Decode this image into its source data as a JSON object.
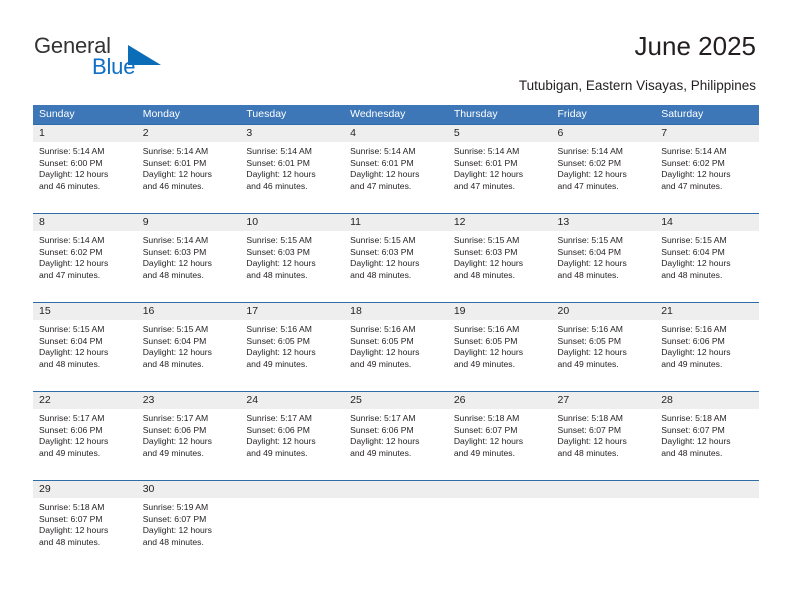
{
  "brand": {
    "name_top": "General",
    "name_bottom": "Blue",
    "triangle_icon": "triangle-icon",
    "color_top": "#333333",
    "color_bottom": "#0f6fc5",
    "color_triangle": "#0b6cb7"
  },
  "header": {
    "title": "June 2025",
    "subtitle": "Tutubigan, Eastern Visayas, Philippines"
  },
  "theme": {
    "header_bg": "#3d77b8",
    "header_text": "#ffffff",
    "daynum_bg": "#eeeeee",
    "week_divider": "#2e6da8",
    "body_text": "#231f20"
  },
  "calendar": {
    "weekday_headers": [
      "Sunday",
      "Monday",
      "Tuesday",
      "Wednesday",
      "Thursday",
      "Friday",
      "Saturday"
    ],
    "weeks": [
      {
        "daynums": [
          "1",
          "2",
          "3",
          "4",
          "5",
          "6",
          "7"
        ],
        "days": [
          {
            "day": "1",
            "sunrise": "Sunrise: 5:14 AM",
            "sunset": "Sunset: 6:00 PM",
            "daylight1": "Daylight: 12 hours",
            "daylight2": "and 46 minutes."
          },
          {
            "day": "2",
            "sunrise": "Sunrise: 5:14 AM",
            "sunset": "Sunset: 6:01 PM",
            "daylight1": "Daylight: 12 hours",
            "daylight2": "and 46 minutes."
          },
          {
            "day": "3",
            "sunrise": "Sunrise: 5:14 AM",
            "sunset": "Sunset: 6:01 PM",
            "daylight1": "Daylight: 12 hours",
            "daylight2": "and 46 minutes."
          },
          {
            "day": "4",
            "sunrise": "Sunrise: 5:14 AM",
            "sunset": "Sunset: 6:01 PM",
            "daylight1": "Daylight: 12 hours",
            "daylight2": "and 47 minutes."
          },
          {
            "day": "5",
            "sunrise": "Sunrise: 5:14 AM",
            "sunset": "Sunset: 6:01 PM",
            "daylight1": "Daylight: 12 hours",
            "daylight2": "and 47 minutes."
          },
          {
            "day": "6",
            "sunrise": "Sunrise: 5:14 AM",
            "sunset": "Sunset: 6:02 PM",
            "daylight1": "Daylight: 12 hours",
            "daylight2": "and 47 minutes."
          },
          {
            "day": "7",
            "sunrise": "Sunrise: 5:14 AM",
            "sunset": "Sunset: 6:02 PM",
            "daylight1": "Daylight: 12 hours",
            "daylight2": "and 47 minutes."
          }
        ]
      },
      {
        "daynums": [
          "8",
          "9",
          "10",
          "11",
          "12",
          "13",
          "14"
        ],
        "days": [
          {
            "day": "8",
            "sunrise": "Sunrise: 5:14 AM",
            "sunset": "Sunset: 6:02 PM",
            "daylight1": "Daylight: 12 hours",
            "daylight2": "and 47 minutes."
          },
          {
            "day": "9",
            "sunrise": "Sunrise: 5:14 AM",
            "sunset": "Sunset: 6:03 PM",
            "daylight1": "Daylight: 12 hours",
            "daylight2": "and 48 minutes."
          },
          {
            "day": "10",
            "sunrise": "Sunrise: 5:15 AM",
            "sunset": "Sunset: 6:03 PM",
            "daylight1": "Daylight: 12 hours",
            "daylight2": "and 48 minutes."
          },
          {
            "day": "11",
            "sunrise": "Sunrise: 5:15 AM",
            "sunset": "Sunset: 6:03 PM",
            "daylight1": "Daylight: 12 hours",
            "daylight2": "and 48 minutes."
          },
          {
            "day": "12",
            "sunrise": "Sunrise: 5:15 AM",
            "sunset": "Sunset: 6:03 PM",
            "daylight1": "Daylight: 12 hours",
            "daylight2": "and 48 minutes."
          },
          {
            "day": "13",
            "sunrise": "Sunrise: 5:15 AM",
            "sunset": "Sunset: 6:04 PM",
            "daylight1": "Daylight: 12 hours",
            "daylight2": "and 48 minutes."
          },
          {
            "day": "14",
            "sunrise": "Sunrise: 5:15 AM",
            "sunset": "Sunset: 6:04 PM",
            "daylight1": "Daylight: 12 hours",
            "daylight2": "and 48 minutes."
          }
        ]
      },
      {
        "daynums": [
          "15",
          "16",
          "17",
          "18",
          "19",
          "20",
          "21"
        ],
        "days": [
          {
            "day": "15",
            "sunrise": "Sunrise: 5:15 AM",
            "sunset": "Sunset: 6:04 PM",
            "daylight1": "Daylight: 12 hours",
            "daylight2": "and 48 minutes."
          },
          {
            "day": "16",
            "sunrise": "Sunrise: 5:15 AM",
            "sunset": "Sunset: 6:04 PM",
            "daylight1": "Daylight: 12 hours",
            "daylight2": "and 48 minutes."
          },
          {
            "day": "17",
            "sunrise": "Sunrise: 5:16 AM",
            "sunset": "Sunset: 6:05 PM",
            "daylight1": "Daylight: 12 hours",
            "daylight2": "and 49 minutes."
          },
          {
            "day": "18",
            "sunrise": "Sunrise: 5:16 AM",
            "sunset": "Sunset: 6:05 PM",
            "daylight1": "Daylight: 12 hours",
            "daylight2": "and 49 minutes."
          },
          {
            "day": "19",
            "sunrise": "Sunrise: 5:16 AM",
            "sunset": "Sunset: 6:05 PM",
            "daylight1": "Daylight: 12 hours",
            "daylight2": "and 49 minutes."
          },
          {
            "day": "20",
            "sunrise": "Sunrise: 5:16 AM",
            "sunset": "Sunset: 6:05 PM",
            "daylight1": "Daylight: 12 hours",
            "daylight2": "and 49 minutes."
          },
          {
            "day": "21",
            "sunrise": "Sunrise: 5:16 AM",
            "sunset": "Sunset: 6:06 PM",
            "daylight1": "Daylight: 12 hours",
            "daylight2": "and 49 minutes."
          }
        ]
      },
      {
        "daynums": [
          "22",
          "23",
          "24",
          "25",
          "26",
          "27",
          "28"
        ],
        "days": [
          {
            "day": "22",
            "sunrise": "Sunrise: 5:17 AM",
            "sunset": "Sunset: 6:06 PM",
            "daylight1": "Daylight: 12 hours",
            "daylight2": "and 49 minutes."
          },
          {
            "day": "23",
            "sunrise": "Sunrise: 5:17 AM",
            "sunset": "Sunset: 6:06 PM",
            "daylight1": "Daylight: 12 hours",
            "daylight2": "and 49 minutes."
          },
          {
            "day": "24",
            "sunrise": "Sunrise: 5:17 AM",
            "sunset": "Sunset: 6:06 PM",
            "daylight1": "Daylight: 12 hours",
            "daylight2": "and 49 minutes."
          },
          {
            "day": "25",
            "sunrise": "Sunrise: 5:17 AM",
            "sunset": "Sunset: 6:06 PM",
            "daylight1": "Daylight: 12 hours",
            "daylight2": "and 49 minutes."
          },
          {
            "day": "26",
            "sunrise": "Sunrise: 5:18 AM",
            "sunset": "Sunset: 6:07 PM",
            "daylight1": "Daylight: 12 hours",
            "daylight2": "and 49 minutes."
          },
          {
            "day": "27",
            "sunrise": "Sunrise: 5:18 AM",
            "sunset": "Sunset: 6:07 PM",
            "daylight1": "Daylight: 12 hours",
            "daylight2": "and 48 minutes."
          },
          {
            "day": "28",
            "sunrise": "Sunrise: 5:18 AM",
            "sunset": "Sunset: 6:07 PM",
            "daylight1": "Daylight: 12 hours",
            "daylight2": "and 48 minutes."
          }
        ]
      },
      {
        "daynums": [
          "29",
          "30",
          "",
          "",
          "",
          "",
          ""
        ],
        "days": [
          {
            "day": "29",
            "sunrise": "Sunrise: 5:18 AM",
            "sunset": "Sunset: 6:07 PM",
            "daylight1": "Daylight: 12 hours",
            "daylight2": "and 48 minutes."
          },
          {
            "day": "30",
            "sunrise": "Sunrise: 5:19 AM",
            "sunset": "Sunset: 6:07 PM",
            "daylight1": "Daylight: 12 hours",
            "daylight2": "and 48 minutes."
          },
          {
            "day": "",
            "sunrise": "",
            "sunset": "",
            "daylight1": "",
            "daylight2": ""
          },
          {
            "day": "",
            "sunrise": "",
            "sunset": "",
            "daylight1": "",
            "daylight2": ""
          },
          {
            "day": "",
            "sunrise": "",
            "sunset": "",
            "daylight1": "",
            "daylight2": ""
          },
          {
            "day": "",
            "sunrise": "",
            "sunset": "",
            "daylight1": "",
            "daylight2": ""
          },
          {
            "day": "",
            "sunrise": "",
            "sunset": "",
            "daylight1": "",
            "daylight2": ""
          }
        ]
      }
    ]
  }
}
